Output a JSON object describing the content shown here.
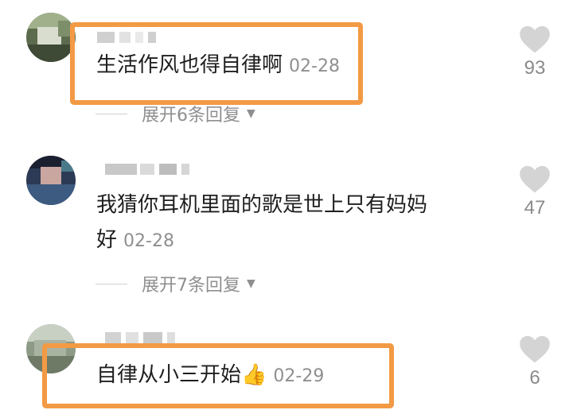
{
  "comments": [
    {
      "text": "生活作风也得自律啊",
      "date": "02-28",
      "likes": "93",
      "expand_label": "展开6条回复",
      "expand_arrow": "▼"
    },
    {
      "text": "我猜你耳机里面的歌是世上只有妈妈\n好",
      "date": "02-28",
      "likes": "47",
      "expand_label": "展开7条回复",
      "expand_arrow": "▼"
    },
    {
      "text": "自律从小三开始",
      "emoji": "👍",
      "date": "02-29",
      "likes": "6"
    }
  ],
  "colors": {
    "highlight": "#f39a45",
    "heart": "#d4d4d4",
    "muted_text": "#8f8f8f"
  },
  "icons": {
    "like": "heart-icon",
    "expand": "triangle-down-icon",
    "emoji": "thumbs-up-emoji"
  }
}
